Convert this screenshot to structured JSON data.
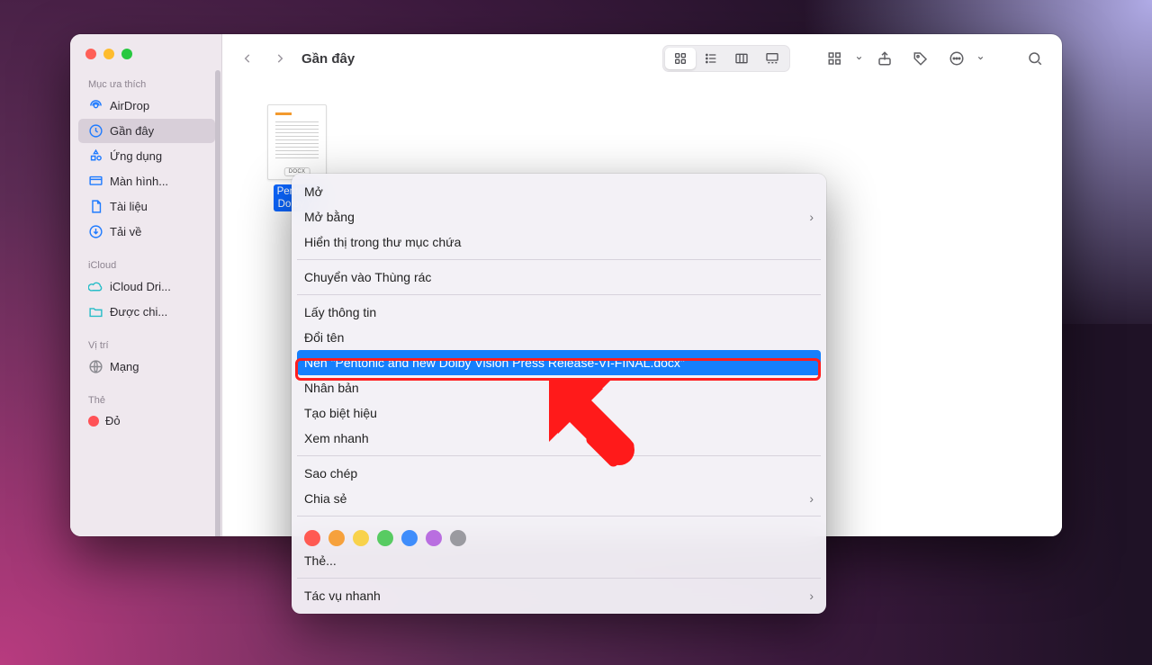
{
  "window": {
    "title": "Gần đây"
  },
  "sidebar": {
    "section_favorites": "Mục ưa thích",
    "items": [
      {
        "label": "AirDrop"
      },
      {
        "label": "Gần đây"
      },
      {
        "label": "Ứng dụng"
      },
      {
        "label": "Màn hình..."
      },
      {
        "label": "Tài liệu"
      },
      {
        "label": "Tải về"
      }
    ],
    "section_icloud": "iCloud",
    "icloud_items": [
      {
        "label": "iCloud Dri..."
      },
      {
        "label": "Được chi..."
      }
    ],
    "section_locations": "Vị trí",
    "loc_items": [
      {
        "label": "Mạng"
      }
    ],
    "section_tags": "Thẻ",
    "tag_items": [
      {
        "label": "Đỏ"
      }
    ]
  },
  "file": {
    "name_line1": "Pentonic",
    "name_line2": "Dolby Vi",
    "badge": "DOCX"
  },
  "context_menu": {
    "open": "Mở",
    "open_with": "Mở bằng",
    "show_in_folder": "Hiển thị trong thư mục chứa",
    "move_to_trash": "Chuyển vào Thùng rác",
    "get_info": "Lấy thông tin",
    "rename": "Đổi tên",
    "compress": "Nén \"Pentonic and new Dolby Vision Press Release-VI-FINAL.docx\"",
    "duplicate": "Nhân bản",
    "make_alias": "Tạo biệt hiệu",
    "quick_look": "Xem nhanh",
    "copy": "Sao chép",
    "share": "Chia sẻ",
    "tags_label": "Thẻ...",
    "quick_actions": "Tác vụ nhanh"
  }
}
